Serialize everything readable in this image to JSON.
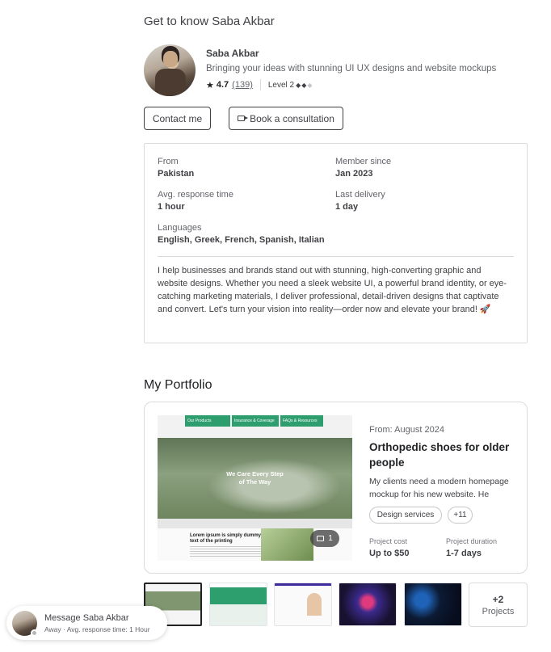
{
  "about": {
    "title": "Get to know Saba Akbar",
    "name": "Saba Akbar",
    "tagline": "Bringing your ideas with stunning UI UX designs and website mockups",
    "rating": "4.7",
    "reviews": "(139)",
    "level": "Level 2",
    "contact_label": "Contact me",
    "book_label": "Book a consultation"
  },
  "info": {
    "from_label": "From",
    "from_value": "Pakistan",
    "member_label": "Member since",
    "member_value": "Jan 2023",
    "response_label": "Avg. response time",
    "response_value": "1 hour",
    "delivery_label": "Last delivery",
    "delivery_value": "1 day",
    "languages_label": "Languages",
    "languages_value": "English, Greek, French, Spanish, Italian",
    "description": "I help businesses and brands stand out with stunning, high-converting graphic and website designs. Whether you need a sleek website UI, a powerful brand identity, or eye-catching marketing materials, I deliver professional, detail-driven designs that captivate and convert. Let's turn your vision into reality—order now and elevate your brand! 🚀"
  },
  "portfolio": {
    "title": "My Portfolio",
    "image": {
      "tabs": [
        "Our Products",
        "Insurance & Coverage",
        "FAQs & Resources"
      ],
      "hero_line1": "We Care Every Step",
      "hero_line2": "of The Way",
      "bottom_heading": "Lorem ipsum is simply dummy text of the printing",
      "photo_count": "1"
    },
    "date": "From: August 2024",
    "project_title": "Orthopedic shoes for older people",
    "description": "My clients need a modern homepage mockup for his new website. He",
    "tag1": "Design services",
    "tag2": "+11",
    "cost_label": "Project cost",
    "cost_value": "Up to $50",
    "duration_label": "Project duration",
    "duration_value": "1-7 days",
    "more_count": "+2",
    "more_label": "Projects"
  },
  "message": {
    "title": "Message Saba Akbar",
    "status": "Away",
    "response": "Avg. response time: 1 Hour"
  },
  "colors": {
    "accent": "#2e9e6e",
    "text": "#404145",
    "muted": "#62646a",
    "border": "#dadbdd"
  }
}
